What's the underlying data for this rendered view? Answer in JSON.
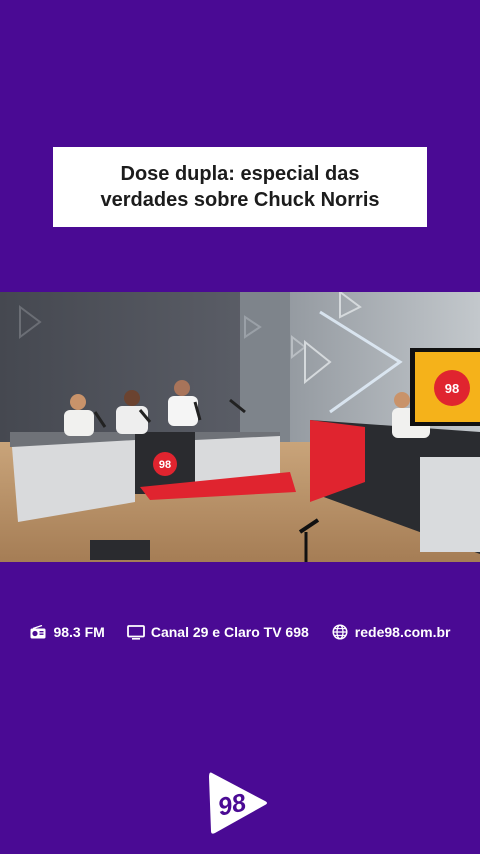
{
  "title": "Dose dupla: especial das\nverdades sobre Chuck Norris",
  "video": {
    "studio_logo_text": "98",
    "screen_logo_text": "98"
  },
  "info_bar": {
    "radio": {
      "icon": "radio-icon",
      "label": "98.3 FM"
    },
    "tv": {
      "icon": "tv-icon",
      "label": "Canal 29 e Claro TV 698"
    },
    "web": {
      "icon": "globe-icon",
      "label": "rede98.com.br"
    }
  },
  "brand": {
    "logo_text": "98",
    "background_color": "#4a0a94",
    "accent_red": "#e0242f"
  }
}
